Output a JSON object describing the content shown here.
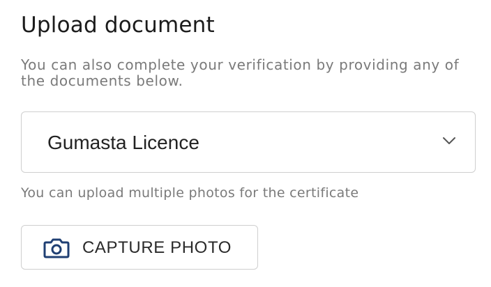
{
  "heading": "Upload document",
  "description": "You can also complete your verification by providing any of the documents below.",
  "document_select": {
    "value": "Gumasta Licence",
    "icon": "chevron-down-icon"
  },
  "hint": "You can upload multiple photos for the certificate",
  "capture_button": {
    "label": "CAPTURE PHOTO",
    "icon": "camera-icon",
    "icon_color": "#1f3f73"
  }
}
